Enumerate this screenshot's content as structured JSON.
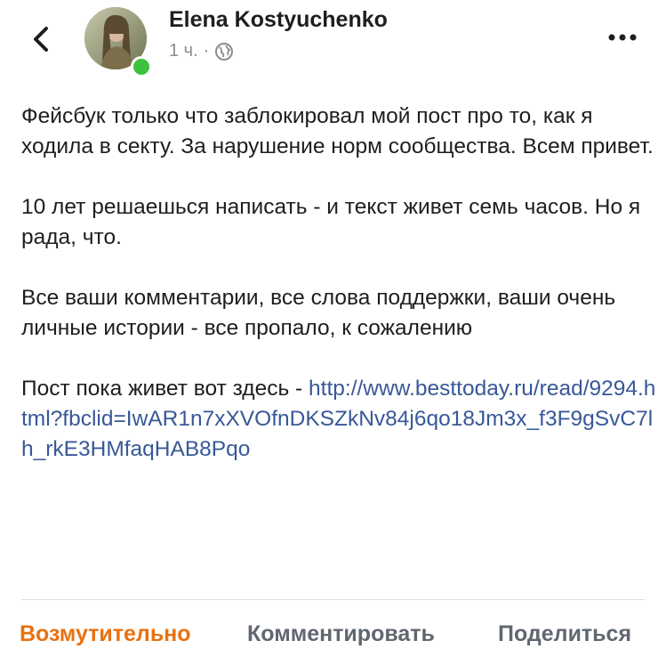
{
  "header": {
    "author_name": "Elena Kostyuchenko",
    "timestamp": "1 ч.",
    "separator": "·",
    "privacy_icon": "globe-icon",
    "back_icon": "chevron-left-icon",
    "more_icon": "more-horizontal-icon"
  },
  "post": {
    "paragraphs": [
      "Фейсбук только что заблокировал мой пост про то, как я ходила в секту. За нарушение норм сообщества. Всем привет.",
      "10 лет решаешься написать - и текст живет семь часов. Но я рада, что.",
      "Все ваши комментарии, все слова поддержки, ваши очень личные истории - все пропало, к сожалению"
    ],
    "link_prefix": "Пост пока живет вот здесь - ",
    "link_text": "http://www.besttoday.ru/read/9294.html?fbclid=IwAR1n7xXVOfnDKSZkNv84j6qo18Jm3x_f3F9gSvC7lh_rkE3HMfaqHAB8Pqo"
  },
  "actions": {
    "react_label": "Возмутительно",
    "comment_label": "Комментировать",
    "share_label": "Поделиться"
  },
  "colors": {
    "link": "#385898",
    "reaction_angry": "#e9710f",
    "online": "#3ec13e",
    "muted": "#8a8d91"
  }
}
